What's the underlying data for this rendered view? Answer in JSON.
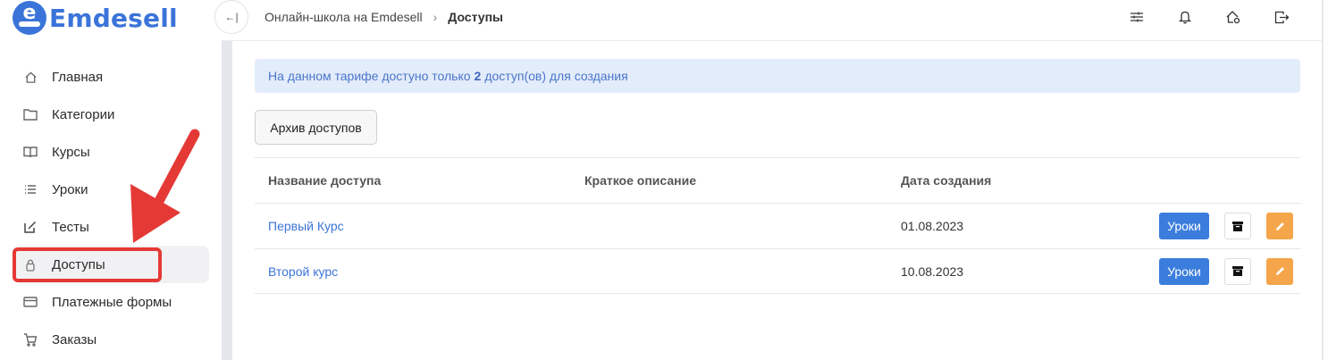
{
  "brand": {
    "name": "Emdesell",
    "badge_letter": "e",
    "color": "#3b74d9"
  },
  "sidebar": {
    "items": [
      {
        "label": "Главная",
        "icon": "home-icon"
      },
      {
        "label": "Категории",
        "icon": "folder-icon"
      },
      {
        "label": "Курсы",
        "icon": "book-icon"
      },
      {
        "label": "Уроки",
        "icon": "list-icon"
      },
      {
        "label": "Тесты",
        "icon": "edit-icon"
      },
      {
        "label": "Доступы",
        "icon": "lock-icon",
        "active": true
      },
      {
        "label": "Платежные формы",
        "icon": "credit-card-icon"
      },
      {
        "label": "Заказы",
        "icon": "cart-icon"
      }
    ]
  },
  "topbar": {
    "collapse_glyph": "←|",
    "breadcrumb": {
      "parent": "Онлайн-школа на Emdesell",
      "separator": "›",
      "current": "Доступы"
    },
    "icons": [
      "sliders-icon",
      "bell-icon",
      "home-gear-icon",
      "logout-icon"
    ]
  },
  "alert": {
    "prefix": "На данном тарифе достуно только",
    "count": "2",
    "suffix": "доступ(ов) для создания"
  },
  "archive_button": "Архив доступов",
  "table": {
    "headers": [
      "Название доступа",
      "Краткое описание",
      "Дата создания"
    ],
    "rows": [
      {
        "name": "Первый Курс",
        "description": "",
        "date": "01.08.2023",
        "lessons_label": "Уроки"
      },
      {
        "name": "Второй курс",
        "description": "",
        "date": "10.08.2023",
        "lessons_label": "Уроки"
      }
    ]
  },
  "colors": {
    "primary": "#3b7ddd",
    "edit": "#f5a54a",
    "annotation": "#e53935",
    "alert_bg": "#e3ecfb"
  }
}
